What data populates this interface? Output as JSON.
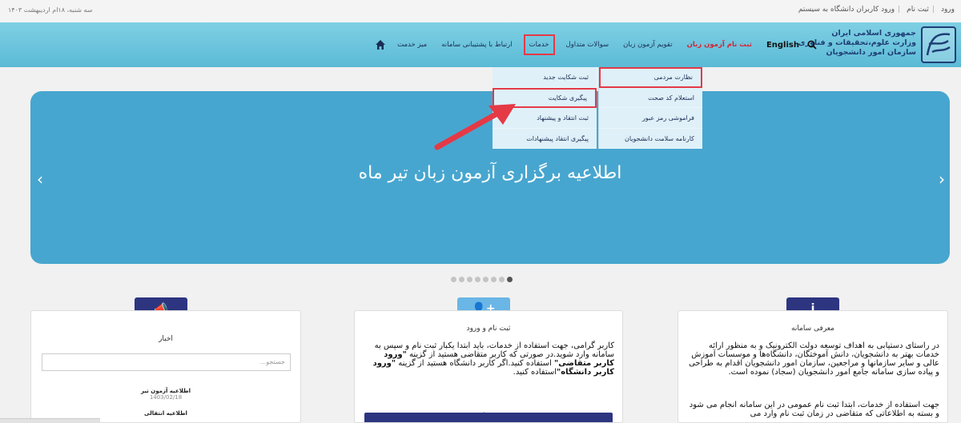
{
  "topbar": {
    "date": "سه شنبه، ۱۸ام اردیبهشت ۱۴۰۳",
    "login": "ورود",
    "register": "ثبت نام",
    "uni_login": "ورود کاربران دانشگاه به سیستم"
  },
  "logo": {
    "line1": "جمهوری اسلامی ایران",
    "line2": "وزارت علوم،تحقیقات و فناوری",
    "line3": "سازمان امور دانشجویان"
  },
  "menu": {
    "desk": "میز خدمت",
    "support": "ارتباط با پشتیبانی سامانه",
    "services": "خدمات",
    "faq": "سوالات متداول",
    "exam_calendar": "تقویم آزمون زبان",
    "exam_register": "ثبت نام آزمون زبان",
    "english": "English"
  },
  "dropdown": {
    "right": [
      "نظارت مردمی",
      "استعلام کد صحت",
      "فراموشی رمز عبور",
      "کارنامه سلامت دانشجویان"
    ],
    "left": [
      "ثبت شکایت جدید",
      "پیگیری شکایت",
      "ثبت انتقاد و پیشنهاد",
      "پیگیری انتقاد پیشنهادات"
    ]
  },
  "hero": {
    "title": "اطلاعیه برگزاری آزمون زبان تیر ماه",
    "prev": "‹",
    "next": "›"
  },
  "cards": {
    "news": {
      "icon": "📣",
      "heading": "اخبار",
      "search_placeholder": "جستجو...",
      "items": [
        {
          "title": "اطلاعیه آزمون تیر",
          "date": "1403/02/18"
        },
        {
          "title": "اطلاعیه انتقالی",
          "date": ""
        }
      ]
    },
    "register": {
      "icon": "👤+",
      "heading": "ثبت نام و ورود",
      "p1": "کاربر گرامی، جهت استفاده از خدمات، باید ابتدا یکبار ثبت نام و سپس به سامانه وارد شوید.در صورتی که کاربر متقاضی هستید از گزینه ",
      "b1": "\"ورود کاربر متقاضی\"",
      "p2": " استفاده کنید.اگر کاربر دانشگاه هستید از گزینه ",
      "b2": "\"ورود کاربر دانشگاه\"",
      "p3": "استفاده کنید.",
      "dot": "."
    },
    "intro": {
      "icon": "i",
      "heading": "معرفی سامانه",
      "p1": "در راستای دستیابی به اهداف توسعه دولت الکترونیک و به منظور ارائه خدمات بهتر به دانشجویان، دانش آموختگان، دانشگاه‌ها و موسسات آموزش عالی و سایر سازمانها و مراجعین، سازمان امور دانشجویان اقدام به طراحی و پیاده سازی سامانه جامع امور دانشجویان (سجاد) نموده است.",
      "p2": "جهت استفاده از خدمات، ابتدا ثبت نام عمومی در این سامانه انجام می شود و بسته به اطلاعاتی که متقاضی در زمان ثبت نام وارد می"
    }
  },
  "colors": {
    "navbar": "#6cc4dd",
    "hero": "#47a6cf",
    "highlight": "#e53946",
    "badge_dark": "#2d3580",
    "badge_light": "#6ab6e6"
  }
}
